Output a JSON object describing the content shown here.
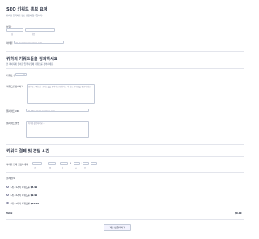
{
  "form": {
    "title": "SEO 키워드 홍보 요청",
    "subtitle": "귀하의 연락처가 정보 요청서 형식입니다."
  },
  "name": {
    "label": "성함",
    "first_value": "",
    "last_value": "",
    "first_sublabel": "성",
    "last_sublabel": "이름"
  },
  "email": {
    "label": "이메일",
    "placeholder": "예: myname@example.com"
  },
  "keyword_section": {
    "title": "귀하의 키워드들을 정의하세요",
    "subtitle": "본 페이지에 들어갈 입력 사항에 키워드를 정의하세요."
  },
  "keyword_count": {
    "label": "키워드 수",
    "value": "1"
  },
  "keyword_define": {
    "label": "키워드를 정의하기",
    "placeholder": "원하는 키워드나 키워드들을 정의하고 입력하고 이 필드 기재란을 완료하세요."
  },
  "website": {
    "label": "웹사이트 URL",
    "placeholder": "예: http://www.example.com"
  },
  "additional": {
    "label": "웹사이트 설명",
    "placeholder": "여기에 설명하세요..."
  },
  "payment_section": {
    "title": "키워드 결제 및 견딜 시간"
  },
  "datetime": {
    "label": "구매한 언제 필요하세까",
    "year": "2024",
    "month": "02",
    "day": "30",
    "hour": "10",
    "minute": "10",
    "ampm": "AM",
    "year_sub": "년",
    "month_sub": "월",
    "day_sub": "일",
    "hour_sub": "시",
    "minute_sub": "분"
  },
  "products": {
    "label": "결제 선택",
    "items": [
      {
        "name": "1개 - 1개의 키워드를",
        "price": "$4.99"
      },
      {
        "name": "2개 - 2개의 키워드를",
        "price": "$9.99"
      },
      {
        "name": "3개 - 3개의 키워드를",
        "price": "$14.99"
      }
    ]
  },
  "total": {
    "label": "Total",
    "value": "$0.00"
  },
  "submit": {
    "label": "제출 및 결제하기"
  },
  "colors": {
    "text": "#2c3345",
    "border": "#c3cad8",
    "button_bg": "#f3f3fe",
    "required": "#f23a3c"
  }
}
